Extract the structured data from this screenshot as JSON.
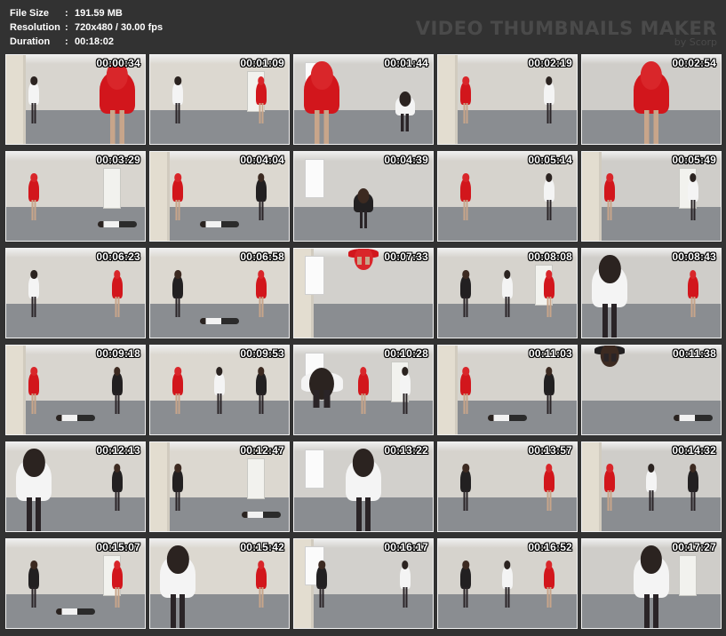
{
  "info": {
    "rows": [
      {
        "label": "File Size",
        "sep": ":",
        "value": "191.59 MB"
      },
      {
        "label": "Resolution",
        "sep": ":",
        "value": "720x480 / 30.00 fps"
      },
      {
        "label": "Duration",
        "sep": ":",
        "value": "00:18:02"
      }
    ]
  },
  "brand": {
    "title": "VIDEO THUMBNAILS MAKER",
    "subtitle": "by Scorp"
  },
  "thumbnails": [
    {
      "time": "00:00:34"
    },
    {
      "time": "00:01:09"
    },
    {
      "time": "00:01:44"
    },
    {
      "time": "00:02:19"
    },
    {
      "time": "00:02:54"
    },
    {
      "time": "00:03:29"
    },
    {
      "time": "00:04:04"
    },
    {
      "time": "00:04:39"
    },
    {
      "time": "00:05:14"
    },
    {
      "time": "00:05:49"
    },
    {
      "time": "00:06:23"
    },
    {
      "time": "00:06:58"
    },
    {
      "time": "00:07:33"
    },
    {
      "time": "00:08:08"
    },
    {
      "time": "00:08:43"
    },
    {
      "time": "00:09:18"
    },
    {
      "time": "00:09:53"
    },
    {
      "time": "00:10:28"
    },
    {
      "time": "00:11:03"
    },
    {
      "time": "00:11:38"
    },
    {
      "time": "00:12:13"
    },
    {
      "time": "00:12:47"
    },
    {
      "time": "00:13:22"
    },
    {
      "time": "00:13:57"
    },
    {
      "time": "00:14:32"
    },
    {
      "time": "00:15:07"
    },
    {
      "time": "00:15:42"
    },
    {
      "time": "00:16:17"
    },
    {
      "time": "00:16:52"
    },
    {
      "time": "00:17:27"
    }
  ],
  "colors": {
    "background": "#323232",
    "frame_border": "#f2f2f2",
    "timestamp": "#ffffff",
    "brand_text": "#4a4a4a"
  }
}
